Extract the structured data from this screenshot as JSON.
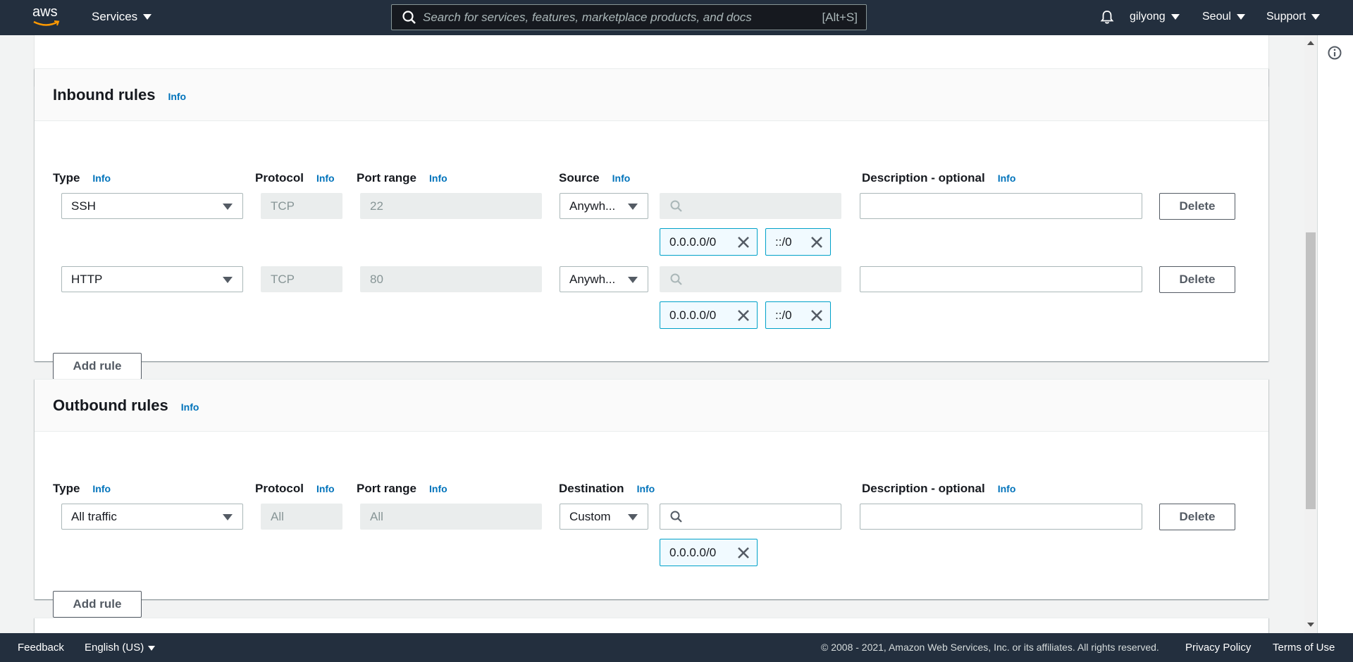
{
  "nav": {
    "logo": "aws",
    "services_label": "Services",
    "search_placeholder": "Search for services, features, marketplace products, and docs",
    "search_shortcut": "[Alt+S]",
    "user_label": "gilyong",
    "region_label": "Seoul",
    "support_label": "Support"
  },
  "inbound": {
    "title": "Inbound rules",
    "info": "Info",
    "columns": {
      "type": "Type",
      "protocol": "Protocol",
      "port_range": "Port range",
      "source": "Source",
      "description": "Description - optional",
      "info": "Info"
    },
    "rules": [
      {
        "type": "SSH",
        "protocol": "TCP",
        "port_range": "22",
        "source": "Anywh...",
        "search_value": "",
        "description": "",
        "tokens": [
          "0.0.0.0/0",
          "::/0"
        ],
        "delete_label": "Delete"
      },
      {
        "type": "HTTP",
        "protocol": "TCP",
        "port_range": "80",
        "source": "Anywh...",
        "search_value": "",
        "description": "",
        "tokens": [
          "0.0.0.0/0",
          "::/0"
        ],
        "delete_label": "Delete"
      }
    ],
    "add_rule_label": "Add rule"
  },
  "outbound": {
    "title": "Outbound rules",
    "info": "Info",
    "columns": {
      "type": "Type",
      "protocol": "Protocol",
      "port_range": "Port range",
      "destination": "Destination",
      "description": "Description - optional",
      "info": "Info"
    },
    "rules": [
      {
        "type": "All traffic",
        "protocol": "All",
        "port_range": "All",
        "destination": "Custom",
        "search_value": "",
        "description": "",
        "tokens": [
          "0.0.0.0/0"
        ],
        "delete_label": "Delete"
      }
    ],
    "add_rule_label": "Add rule"
  },
  "footer": {
    "feedback": "Feedback",
    "language": "English (US)",
    "copyright": "© 2008 - 2021, Amazon Web Services, Inc. or its affiliates. All rights reserved.",
    "privacy": "Privacy Policy",
    "terms": "Terms of Use"
  },
  "colors": {
    "nav_bg": "#232f3e",
    "info_link": "#0073bb",
    "token_border": "#00a1c9",
    "token_bg": "#f1faff",
    "page_bg": "#f2f3f3"
  }
}
